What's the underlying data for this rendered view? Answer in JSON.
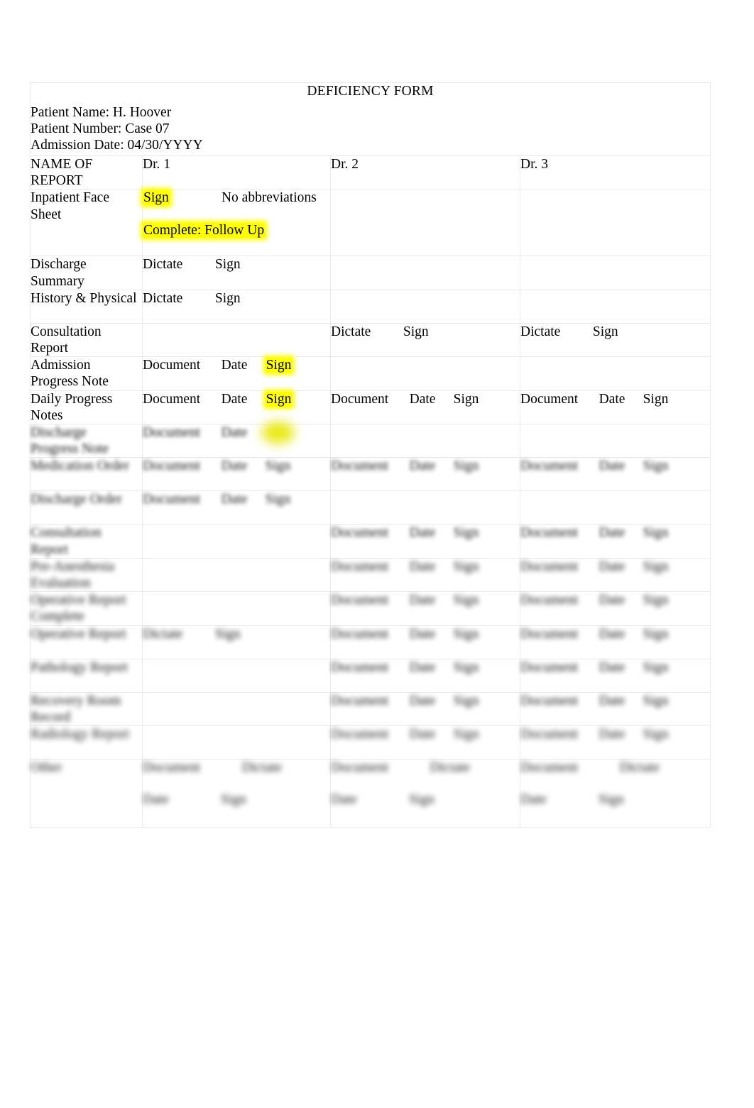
{
  "document": {
    "title": "DEFICIENCY FORM",
    "patient_name_line": "Patient Name: H. Hoover",
    "patient_number_line": "Patient Number: Case 07",
    "admission_date_line": "Admission Date: 04/30/YYYY",
    "highlight_color": "#ffff00"
  },
  "table": {
    "headers": {
      "name_of_report_line1": "NAME OF",
      "name_of_report_line2": "REPORT",
      "dr1": "Dr. 1",
      "dr2": "Dr. 2",
      "dr3": "Dr. 3"
    },
    "rows": [
      {
        "label_line1": "Inpatient Face",
        "label_line2": "Sheet",
        "dr1": [
          "Sign",
          "No abbreviations"
        ],
        "dr1_second_line": [
          "Complete: Follow Up"
        ],
        "dr2": [],
        "dr3": []
      },
      {
        "label_line1": "Discharge",
        "label_line2": "Summary",
        "dr1": [
          "Dictate",
          "Sign"
        ],
        "dr2": [],
        "dr3": []
      },
      {
        "label_line1": "History & Physical",
        "label_line2": "",
        "dr1": [
          "Dictate",
          "Sign"
        ],
        "dr2": [],
        "dr3": []
      },
      {
        "label_line1": "Consultation",
        "label_line2": "Report",
        "dr1": [],
        "dr2": [
          "Dictate",
          "Sign"
        ],
        "dr3": [
          "Dictate",
          "Sign"
        ]
      },
      {
        "label_line1": "Admission",
        "label_line2": "Progress Note",
        "dr1": [
          "Document",
          "Date",
          "Sign"
        ],
        "dr2": [],
        "dr3": []
      },
      {
        "label_line1": "Daily Progress",
        "label_line2": "Notes",
        "dr1": [
          "Document",
          "Date",
          "Sign"
        ],
        "dr2": [
          "Document",
          "Date",
          "Sign"
        ],
        "dr3": [
          "Document",
          "Date",
          "Sign"
        ]
      },
      {
        "label_line1": "Discharge",
        "label_line2": "Progress Note",
        "dr1": [
          "Document",
          "Date",
          "Sign"
        ],
        "dr2": [],
        "dr3": []
      },
      {
        "label_line1": "Medication Order",
        "label_line2": "",
        "dr1": [
          "Document",
          "Date",
          "Sign"
        ],
        "dr2": [
          "Document",
          "Date",
          "Sign"
        ],
        "dr3": [
          "Document",
          "Date",
          "Sign"
        ]
      },
      {
        "label_line1": "Discharge Order",
        "label_line2": "",
        "dr1": [
          "Document",
          "Date",
          "Sign"
        ],
        "dr2": [],
        "dr3": []
      },
      {
        "label_line1": "Consultation",
        "label_line2": "Report",
        "dr1": [],
        "dr2": [
          "Document",
          "Date",
          "Sign"
        ],
        "dr3": [
          "Document",
          "Date",
          "Sign"
        ]
      },
      {
        "label_line1": "Pre-Anesthesia",
        "label_line2": "Evaluation",
        "dr1": [],
        "dr2": [
          "Document",
          "Date",
          "Sign"
        ],
        "dr3": [
          "Document",
          "Date",
          "Sign"
        ]
      },
      {
        "label_line1": "Operative Report",
        "label_line2": "Complete",
        "dr1": [],
        "dr2": [
          "Document",
          "Date",
          "Sign"
        ],
        "dr3": [
          "Document",
          "Date",
          "Sign"
        ]
      },
      {
        "label_line1": "Operative Report",
        "label_line2": "",
        "dr1": [
          "Dictate",
          "Sign"
        ],
        "dr2": [
          "Document",
          "Date",
          "Sign"
        ],
        "dr3": [
          "Document",
          "Date",
          "Sign"
        ]
      },
      {
        "label_line1": "Pathology Report",
        "label_line2": "",
        "dr1": [],
        "dr2": [
          "Document",
          "Date",
          "Sign"
        ],
        "dr3": [
          "Document",
          "Date",
          "Sign"
        ]
      },
      {
        "label_line1": "Recovery Room",
        "label_line2": "Record",
        "dr1": [],
        "dr2": [
          "Document",
          "Date",
          "Sign"
        ],
        "dr3": [
          "Document",
          "Date",
          "Sign"
        ]
      },
      {
        "label_line1": "Radiology Report",
        "label_line2": "",
        "dr1": [],
        "dr2": [
          "Document",
          "Date",
          "Sign"
        ],
        "dr3": [
          "Document",
          "Date",
          "Sign"
        ]
      },
      {
        "label_line1": "Other",
        "label_line2": "",
        "dr1": [
          "Document",
          "Dictate"
        ],
        "dr1_second_line": [
          "Date",
          "Sign"
        ],
        "dr2": [
          "Document",
          "Dictate"
        ],
        "dr2_second_line": [
          "Date",
          "Sign"
        ],
        "dr3": [
          "Document",
          "Dictate"
        ],
        "dr3_second_line": [
          "Date",
          "Sign"
        ]
      }
    ]
  }
}
